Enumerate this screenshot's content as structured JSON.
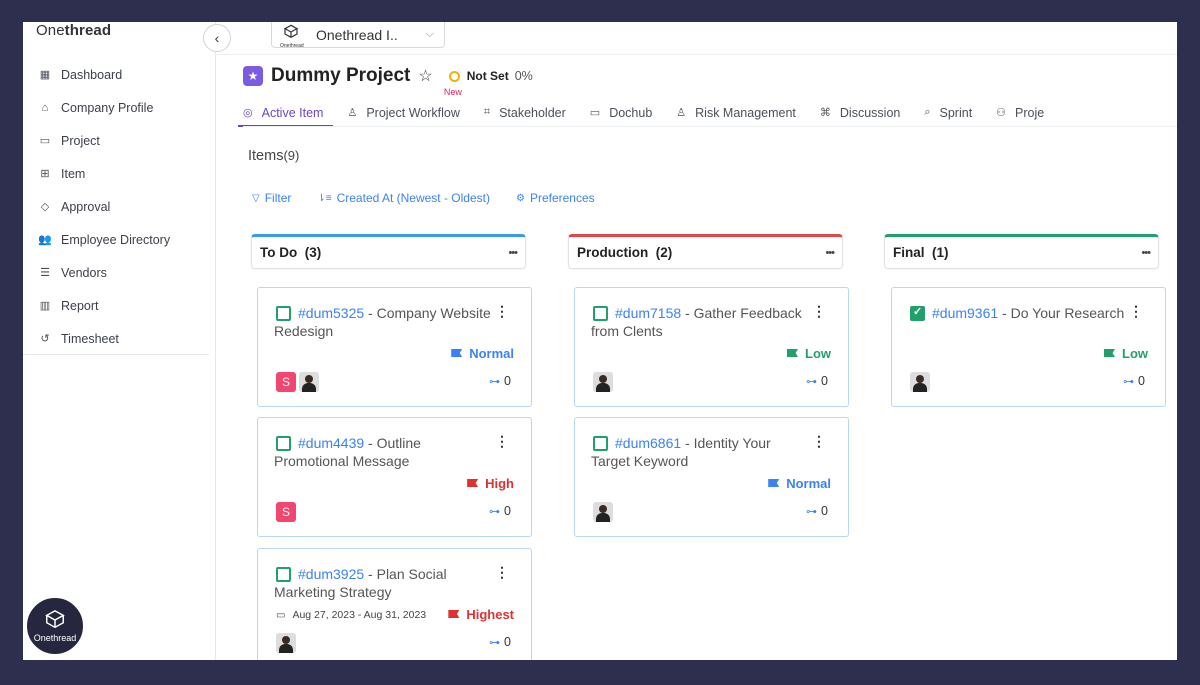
{
  "brand": {
    "name_a": "One",
    "name_b": "thread",
    "badge_label": "Onethread"
  },
  "workspace": {
    "name": "Onethread I..",
    "logo_caption": "Onethread"
  },
  "sidebar": {
    "items": [
      {
        "label": "Dashboard",
        "icon": "dashboard-icon"
      },
      {
        "label": "Company Profile",
        "icon": "building-icon"
      },
      {
        "label": "Project",
        "icon": "folder-icon"
      },
      {
        "label": "Item",
        "icon": "grid-icon"
      },
      {
        "label": "Approval",
        "icon": "shield-check-icon"
      },
      {
        "label": "Employee Directory",
        "icon": "users-icon"
      },
      {
        "label": "Vendors",
        "icon": "vendor-icon"
      },
      {
        "label": "Report",
        "icon": "bar-chart-icon"
      },
      {
        "label": "Timesheet",
        "icon": "clock-history-icon"
      }
    ]
  },
  "project": {
    "title": "Dummy Project",
    "status": "Not Set",
    "progress": "0%",
    "status_color": "#f0b400",
    "accent": "#7b5ce0"
  },
  "tabs": [
    {
      "label": "Active Item",
      "icon": "check-circle-icon",
      "active": true
    },
    {
      "label": "Project Workflow",
      "icon": "workflow-icon",
      "badge": "New"
    },
    {
      "label": "Stakeholder",
      "icon": "stakeholder-icon"
    },
    {
      "label": "Dochub",
      "icon": "folder-icon"
    },
    {
      "label": "Risk Management",
      "icon": "risk-icon"
    },
    {
      "label": "Discussion",
      "icon": "discussion-icon"
    },
    {
      "label": "Sprint",
      "icon": "search-icon"
    },
    {
      "label": "Proje",
      "icon": "project-icon"
    }
  ],
  "items": {
    "title": "Items",
    "count": "(9)"
  },
  "toolbar": {
    "filter": "Filter",
    "sort": "Created At (Newest - Oldest)",
    "preferences": "Preferences"
  },
  "columns": [
    {
      "name": "To Do",
      "count": "(3)",
      "color": "#3b9ae6"
    },
    {
      "name": "Production",
      "count": "(2)",
      "color": "#e04848"
    },
    {
      "name": "Final",
      "count": "(1)",
      "color": "#22a06b"
    }
  ],
  "cards": {
    "c1": {
      "code": "#dum5325",
      "title": " - Company Website Redesign",
      "priority": "Normal",
      "subtasks": "0"
    },
    "c2": {
      "code": "#dum4439",
      "title": " - Outline Promotional Message",
      "priority": "High",
      "subtasks": "0"
    },
    "c3": {
      "code": "#dum3925",
      "title": " - Plan Social Marketing Strategy",
      "priority": "Highest",
      "dates": "Aug 27, 2023 - Aug 31, 2023",
      "subtasks": "0"
    },
    "c4": {
      "code": "#dum7158",
      "title": " - Gather Feedback from Clents",
      "priority": "Low",
      "subtasks": "0"
    },
    "c5": {
      "code": "#dum6861",
      "title": " - Identity Your Target Keyword",
      "priority": "Normal",
      "subtasks": "0"
    },
    "c6": {
      "code": "#dum9361",
      "title": " - Do Your Research",
      "priority": "Low",
      "subtasks": "0",
      "done": true
    }
  },
  "avatar_initial": "S"
}
